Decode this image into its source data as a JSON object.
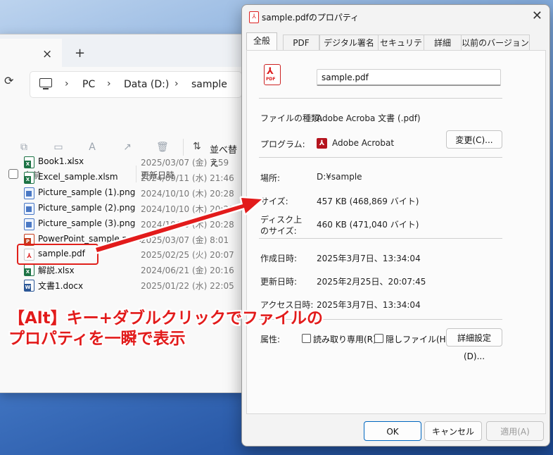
{
  "explorer": {
    "tab_close": "×",
    "tab_new": "+",
    "refresh": "⟳",
    "breadcrumb": [
      "PC",
      "Data (D:)",
      "sample"
    ],
    "toolbar": {
      "sort_label": "並べ替え"
    },
    "columns": {
      "name": "名前",
      "date": "更新日時"
    },
    "files": [
      {
        "name": "Book1.xlsx",
        "date": "2025/03/07 (金) 7:59",
        "type": "xlsx"
      },
      {
        "name": "Excel_sample.xlsm",
        "date": "2024/09/11 (水) 21:46",
        "type": "xlsx"
      },
      {
        "name": "Picture_sample (1).png",
        "date": "2024/10/10 (木) 20:28",
        "type": "png"
      },
      {
        "name": "Picture_sample (2).png",
        "date": "2024/10/10 (木) 20:28",
        "type": "png"
      },
      {
        "name": "Picture_sample (3).png",
        "date": "2024/10/10 (木) 20:28",
        "type": "png"
      },
      {
        "name": "PowerPoint_sample.pptx",
        "date": "2025/03/07 (金) 8:01",
        "type": "pptx"
      },
      {
        "name": "sample.pdf",
        "date": "2025/02/25 (火) 20:07",
        "type": "pdf"
      },
      {
        "name": "解説.xlsx",
        "date": "2024/06/21 (金) 20:16",
        "type": "xlsx"
      },
      {
        "name": "文書1.docx",
        "date": "2025/01/22 (水) 22:05",
        "type": "docx"
      }
    ]
  },
  "dialog": {
    "title": "sample.pdfのプロパティ",
    "close": "✕",
    "tabs": [
      "全般",
      "PDF",
      "デジタル署名",
      "セキュリティ",
      "詳細",
      "以前のバージョン"
    ],
    "active_tab": "全般",
    "file_name": "sample.pdf",
    "labels": {
      "file_type": "ファイルの種類:",
      "program": "プログラム:",
      "location": "場所:",
      "size": "サイズ:",
      "disk_size_line1": "ディスク上",
      "disk_size_line2": "のサイズ:",
      "created": "作成日時:",
      "modified": "更新日時:",
      "accessed": "アクセス日時:",
      "attributes": "属性:"
    },
    "values": {
      "file_type": "Adobe Acroba 文書 (.pdf)",
      "program": "Adobe Acrobat",
      "location": "D:¥sample",
      "size": "457 KB (468,869 バイト)",
      "disk_size": "460 KB (471,040 バイト)",
      "created": "2025年3月7日、13:34:04",
      "modified": "2025年2月25日、20:07:45",
      "accessed": "2025年3月7日、13:34:04"
    },
    "change_button": "変更(C)...",
    "readonly_label": "読み取り専用(R)",
    "hidden_label": "隠しファイル(H)",
    "advanced_button": "詳細設定(D)...",
    "ok_button": "OK",
    "cancel_button": "キャンセル",
    "apply_button": "適用(A)"
  },
  "annotation": {
    "line1": "【Alt】キー+ダブルクリックでファイルの",
    "line2": "プロパティを一瞬で表示"
  },
  "colors": {
    "accent_red": "#e21b1b",
    "pdf_red": "#d22222",
    "primary_blue": "#0067c0"
  }
}
